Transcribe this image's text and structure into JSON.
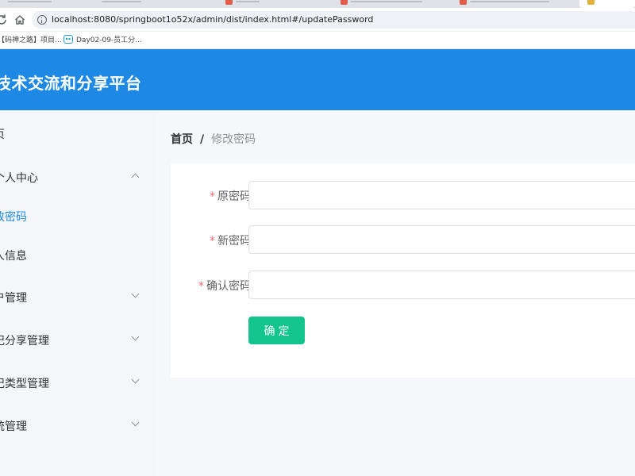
{
  "browser": {
    "url": "localhost:8080/springboot1o52x/admin/dist/index.html#/updatePassword",
    "bookmarks": [
      {
        "label": "【码神之路】项目..."
      },
      {
        "label": "Day02-09-员工分..."
      }
    ]
  },
  "header": {
    "title": "技术交流和分享平台"
  },
  "sidebar": {
    "items": [
      {
        "label": "页"
      },
      {
        "label": "个人中心"
      },
      {
        "label": "改密码"
      },
      {
        "label": "人信息"
      },
      {
        "label": "户管理"
      },
      {
        "label": "记分享管理"
      },
      {
        "label": "记类型管理"
      },
      {
        "label": "统管理"
      }
    ]
  },
  "breadcrumb": {
    "home": "首页",
    "separator": "/",
    "current": "修改密码"
  },
  "form": {
    "required_mark": "*",
    "old_password": {
      "label": "原密码",
      "value": ""
    },
    "new_password": {
      "label": "新密码",
      "value": ""
    },
    "confirm_password": {
      "label": "确认密码",
      "value": ""
    },
    "submit_label": "确定"
  },
  "colors": {
    "header_bg": "#1e88e5",
    "active_menu": "#1e88e5",
    "submit_bg": "#13c48c",
    "required": "#f56c6c"
  }
}
